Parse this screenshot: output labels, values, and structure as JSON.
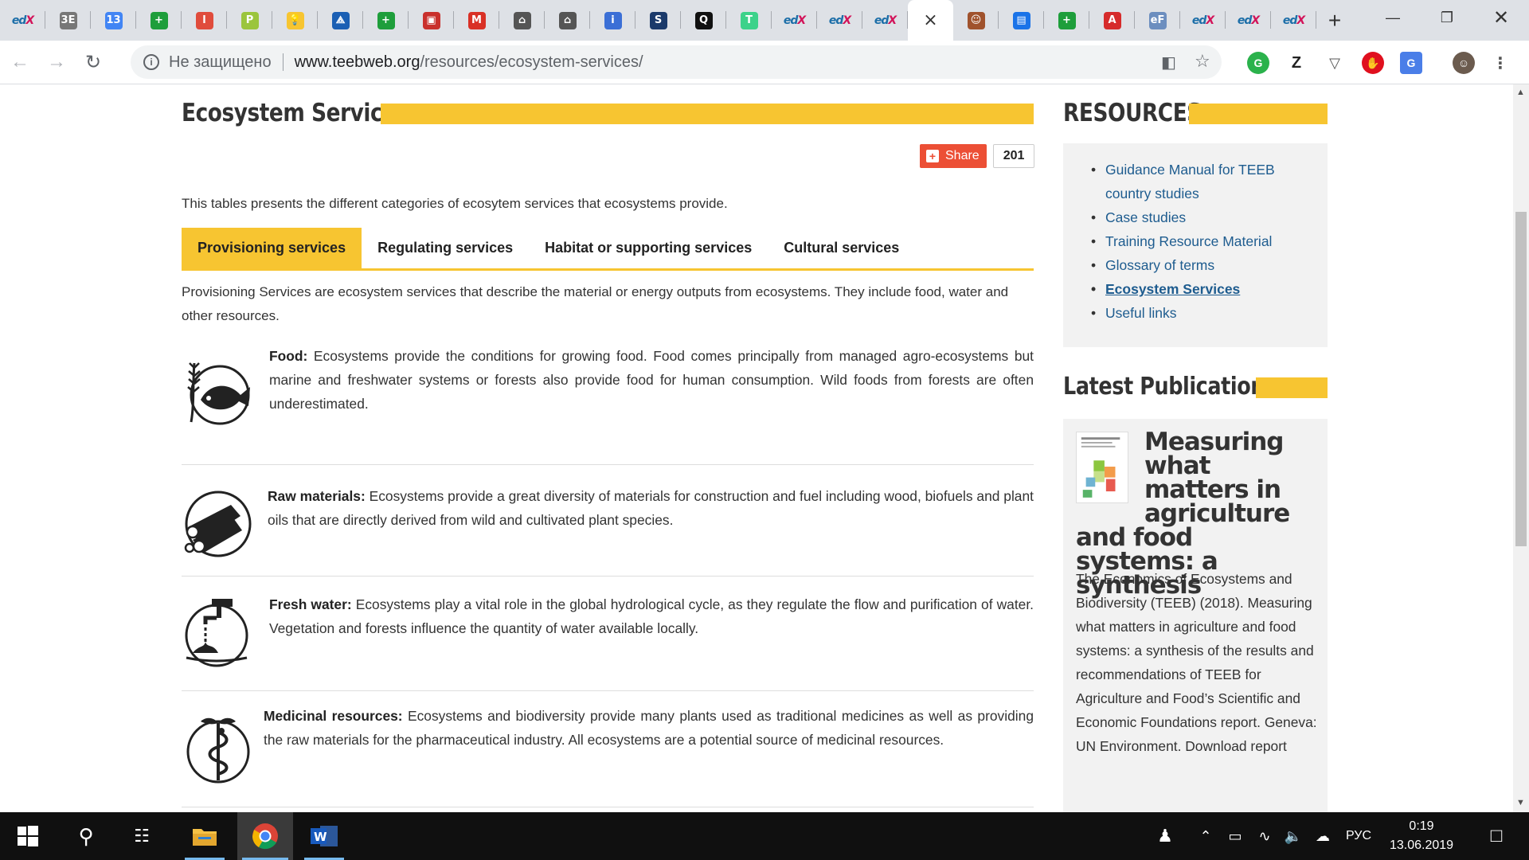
{
  "browser": {
    "tabs": [
      {
        "label": "edX",
        "icon": "edx-icon",
        "color": "#1c6ea8"
      },
      {
        "label": "3E",
        "icon": "document-icon",
        "color": "#777777"
      },
      {
        "label": "13",
        "icon": "calendar-icon",
        "color": "#4285f4"
      },
      {
        "label": "+",
        "icon": "green-plus-icon",
        "color": "#1e9e3b"
      },
      {
        "label": "l",
        "icon": "bookmark-icon",
        "color": "#e04c3c"
      },
      {
        "label": "P",
        "icon": "p-logo-icon",
        "color": "#9bc53d"
      },
      {
        "label": "💡",
        "icon": "lightbulb-icon",
        "color": "#f7c531"
      },
      {
        "label": "⟁",
        "icon": "blue-logo-icon",
        "color": "#1a5fb4"
      },
      {
        "label": "+",
        "icon": "green-plus-icon",
        "color": "#1e9e3b"
      },
      {
        "label": "▣",
        "icon": "red-square-icon",
        "color": "#c9302c"
      },
      {
        "label": "M",
        "icon": "gmail-icon",
        "color": "#d93025"
      },
      {
        "label": "⌂",
        "icon": "columns-icon",
        "color": "#555555"
      },
      {
        "label": "⌂",
        "icon": "columns-icon",
        "color": "#555555"
      },
      {
        "label": "i",
        "icon": "info-icon",
        "color": "#3b6fd6"
      },
      {
        "label": "S",
        "icon": "s-logo-icon",
        "color": "#1b3a6b"
      },
      {
        "label": "Q",
        "icon": "q-logo-icon",
        "color": "#111111"
      },
      {
        "label": "T",
        "icon": "t-logo-icon",
        "color": "#3dd28a"
      },
      {
        "label": "edX",
        "icon": "edx-icon",
        "color": "#1c6ea8"
      },
      {
        "label": "edX",
        "icon": "edx-icon",
        "color": "#1c6ea8"
      },
      {
        "label": "edX",
        "icon": "edx-icon",
        "color": "#1c6ea8"
      },
      {
        "label": "×",
        "icon": "close-icon",
        "color": "#333333",
        "active": true
      },
      {
        "label": "☺",
        "icon": "avatar-icon",
        "color": "#a0522d"
      },
      {
        "label": "▤",
        "icon": "chat-icon",
        "color": "#1a73e8"
      },
      {
        "label": "+",
        "icon": "green-plus-icon",
        "color": "#1e9e3b"
      },
      {
        "label": "A",
        "icon": "acrobat-icon",
        "color": "#d62b2b"
      },
      {
        "label": "eF",
        "icon": "ef-icon",
        "color": "#6c8ebf"
      },
      {
        "label": "edX",
        "icon": "edx-icon",
        "color": "#1c6ea8"
      },
      {
        "label": "edX",
        "icon": "edx-icon",
        "color": "#1c6ea8"
      },
      {
        "label": "edX",
        "icon": "edx-icon",
        "color": "#1c6ea8"
      }
    ],
    "newtab": "+",
    "security_label": "Не защищено",
    "url_host": "www.teebweb.org",
    "url_path": "/resources/ecosystem-services/"
  },
  "page": {
    "title": "Ecosystem Services",
    "share_label": "Share",
    "share_count": "201",
    "intro": "This tables presents the different categories of ecosytem services that ecosystems provide.",
    "tabs": [
      {
        "label": "Provisioning services",
        "active": true
      },
      {
        "label": "Regulating services"
      },
      {
        "label": "Habitat or supporting services"
      },
      {
        "label": "Cultural services"
      }
    ],
    "tab_description": "Provisioning Services are ecosystem services that describe the material or energy outputs from ecosystems. They include food, water and other resources.",
    "services": [
      {
        "name": "Food:",
        "icon": "food-icon",
        "text": " Ecosystems provide the conditions for growing food. Food comes principally from managed agro-ecosystems but marine and freshwater systems or forests also provide food for human consumption. Wild foods from forests are often underestimated."
      },
      {
        "name": "Raw materials:",
        "icon": "logs-icon",
        "text": " Ecosystems provide a great diversity of materials for construction and fuel including wood, biofuels and plant oils that are directly derived from wild and cultivated plant species."
      },
      {
        "name": "Fresh water:",
        "icon": "water-tap-icon",
        "text": " Ecosystems play a vital role in the global hydrological cycle, as they regulate the flow and purification of water. Vegetation and forests influence the quantity of water available locally."
      },
      {
        "name": "Medicinal resources:",
        "icon": "medicine-icon",
        "text": " Ecosystems and biodiversity provide many plants used as traditional medicines as well as providing the raw materials for the pharmaceutical industry. All ecosystems are a potential source of medicinal resources."
      }
    ]
  },
  "sidebar": {
    "resources_title": "RESOURCES",
    "resources": [
      {
        "label": "Guidance Manual for TEEB country studies"
      },
      {
        "label": "Case studies"
      },
      {
        "label": "Training Resource Material"
      },
      {
        "label": "Glossary of terms"
      },
      {
        "label": "Ecosystem Services",
        "current": true
      },
      {
        "label": "Useful links"
      }
    ],
    "publications_title": "Latest Publications",
    "publication_title": "Measuring what matters in agriculture and food systems: a synthesis",
    "publication_desc": "The Economics of Ecosystems and Biodiversity (TEEB) (2018). Measuring what matters in agriculture and food systems: a synthesis of the results and recommendations of TEEB for Agriculture and Food’s Scientific and Economic Foundations report. Geneva: UN Environment. Download report"
  },
  "taskbar": {
    "language": "РУС",
    "time": "0:19",
    "date": "13.06.2019"
  },
  "colors": {
    "accent_yellow": "#f7c531",
    "link_blue": "#1e5c8f",
    "share_red": "#ec4f35"
  }
}
